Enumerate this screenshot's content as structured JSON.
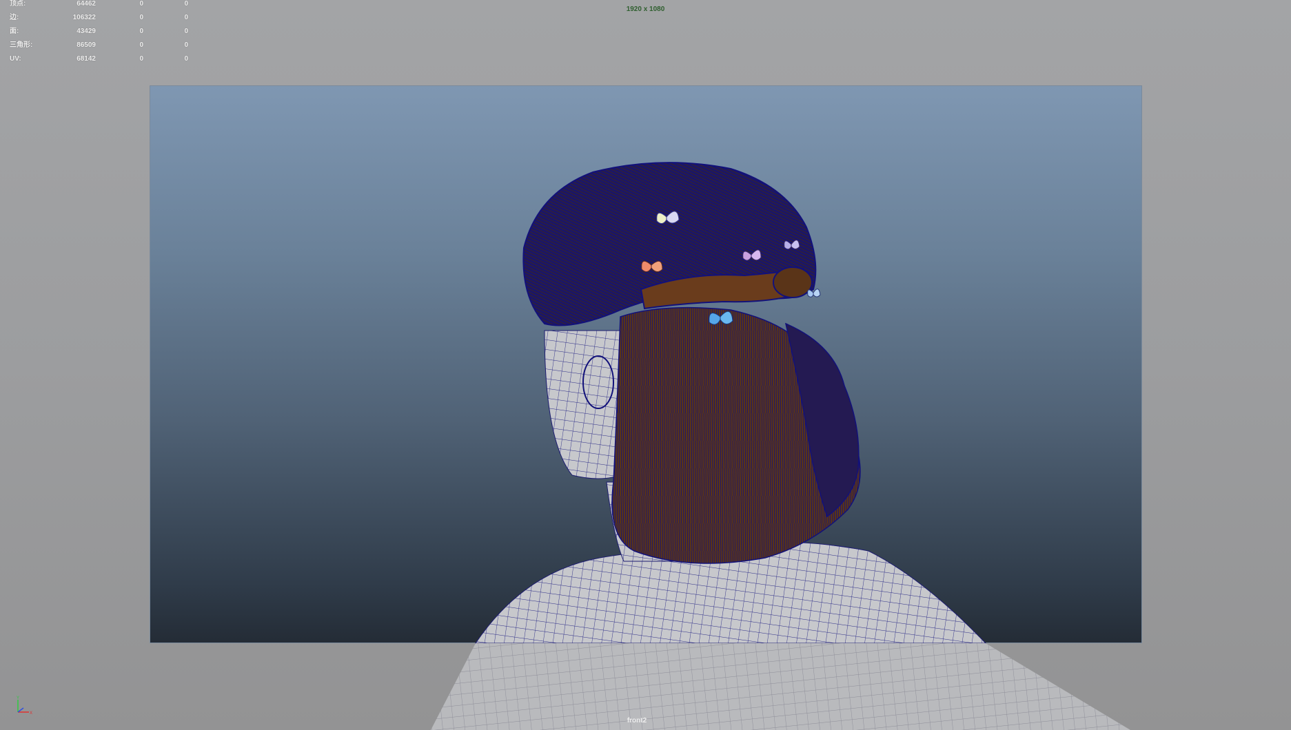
{
  "viewport": {
    "resolution_label": "1920 x 1080",
    "camera_name": "front2"
  },
  "hud": {
    "rows": [
      {
        "label": "顶点:",
        "v1": "64462",
        "v2": "0",
        "v3": "0"
      },
      {
        "label": "边:",
        "v1": "106322",
        "v2": "0",
        "v3": "0"
      },
      {
        "label": "面:",
        "v1": "43429",
        "v2": "0",
        "v3": "0"
      },
      {
        "label": "三角形:",
        "v1": "86509",
        "v2": "0",
        "v3": "0"
      },
      {
        "label": "UV:",
        "v1": "68142",
        "v2": "0",
        "v3": "0"
      }
    ]
  },
  "colors": {
    "wireframe": "#12117a",
    "hair_base": "#5a3418",
    "skin": "#c9c9cc",
    "gate_top": "#7f97b2",
    "gate_bottom": "#242c36"
  },
  "icons": {
    "axis": "axis-gizmo-icon",
    "butterflies": [
      "butterfly-icon",
      "butterfly-icon",
      "butterfly-icon",
      "butterfly-icon",
      "butterfly-icon",
      "butterfly-icon"
    ]
  }
}
